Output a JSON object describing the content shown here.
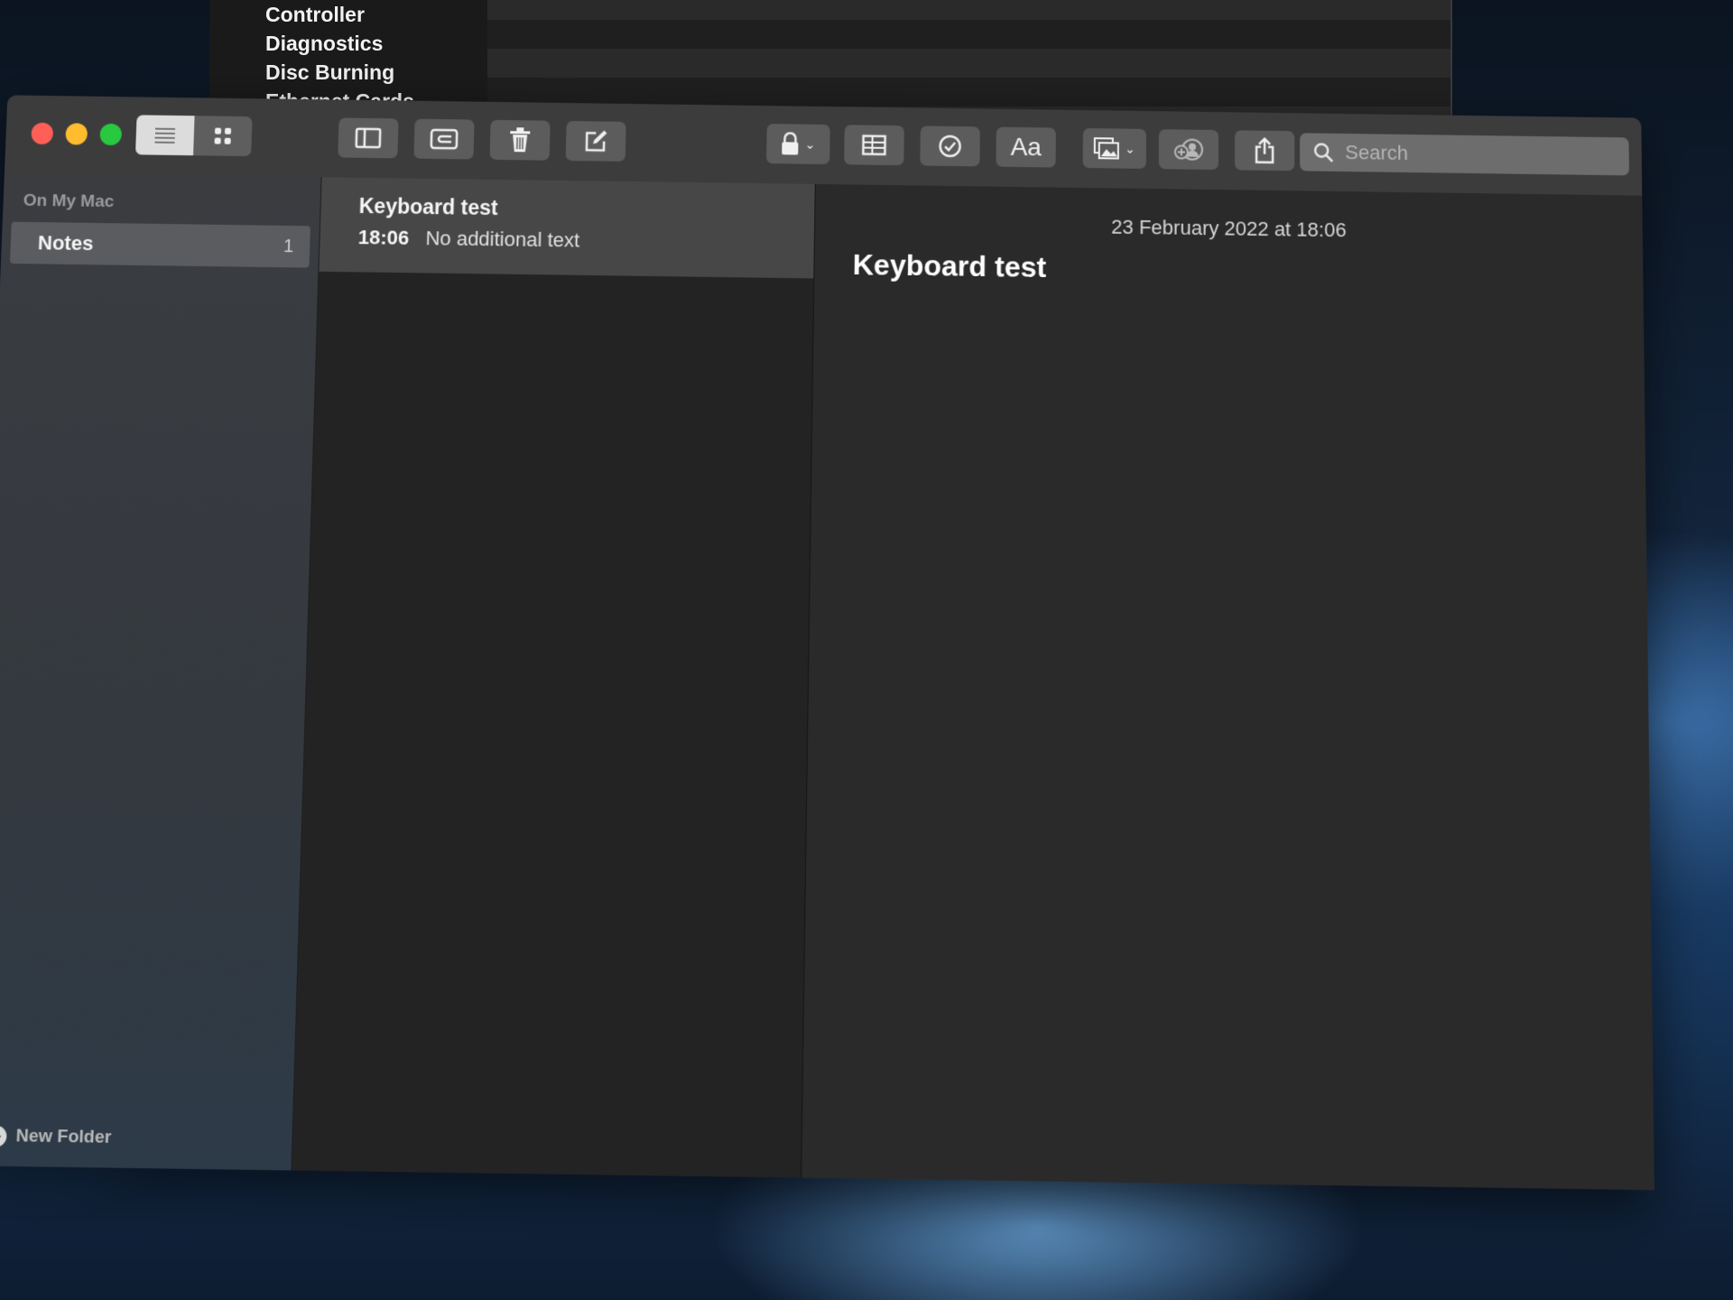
{
  "background_window": {
    "sidebar_items": [
      "Controller",
      "Diagnostics",
      "Disc Burning",
      "Ethernet Cards"
    ]
  },
  "window": {
    "traffic_lights": {
      "close": "#ff5f57",
      "minimize": "#febc2e",
      "zoom": "#28c840"
    },
    "toolbar": {
      "view_list_icon": "list-view-icon",
      "view_gallery_icon": "gallery-view-icon",
      "buttons": [
        {
          "name": "toggle-sidebar",
          "icon": "sidebar-icon"
        },
        {
          "name": "attachments",
          "icon": "attachments-icon"
        },
        {
          "name": "delete",
          "icon": "trash-icon"
        },
        {
          "name": "compose",
          "icon": "compose-icon"
        },
        {
          "name": "lock",
          "icon": "lock-icon"
        },
        {
          "name": "table",
          "icon": "table-icon"
        },
        {
          "name": "checklist",
          "icon": "checklist-icon"
        },
        {
          "name": "format",
          "icon": "format-icon",
          "label": "Aa"
        },
        {
          "name": "media",
          "icon": "photo-icon"
        },
        {
          "name": "collaborate",
          "icon": "add-people-icon"
        },
        {
          "name": "share",
          "icon": "share-icon"
        }
      ],
      "search_placeholder": "Search"
    }
  },
  "sidebar": {
    "section_label": "On My Mac",
    "folders": [
      {
        "name": "Notes",
        "count": "1",
        "selected": true
      }
    ],
    "new_folder_label": "New Folder"
  },
  "note_list": {
    "notes": [
      {
        "title": "Keyboard test",
        "time": "18:06",
        "preview": "No additional text",
        "selected": true
      }
    ]
  },
  "editor": {
    "date": "23 February 2022 at 18:06",
    "title": "Keyboard test"
  }
}
